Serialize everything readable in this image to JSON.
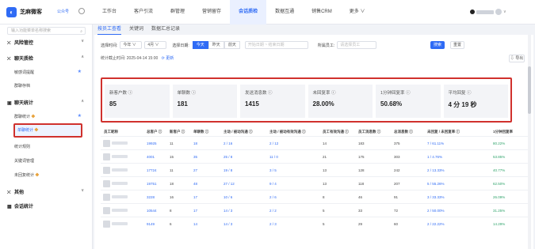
{
  "app": {
    "brand": "芝麻微客",
    "version": "公众号"
  },
  "nav": [
    "工作台",
    "客户引流",
    "群管理",
    "营销留存",
    "会话质检",
    "数据互通",
    "销售CRM",
    "更多"
  ],
  "nav_active_index": 4,
  "user": {
    "label": "..."
  },
  "sidebar": {
    "search_placeholder": "输入功能菜单名称搜索",
    "groups": [
      {
        "label": "风险管控",
        "chevron": "∨"
      },
      {
        "label": "聊天质检",
        "chevron": "∧",
        "items": [
          "敏感词提醒",
          "群聊存档"
        ]
      },
      {
        "label": "聊天统计",
        "chevron": "∧",
        "items": [
          "群聊统计",
          "单聊统计",
          "统计规则",
          "关键词管理",
          "未回复统计"
        ]
      },
      {
        "label": "其他",
        "chevron": "∨"
      },
      {
        "label": "会话统计",
        "chevron": ""
      }
    ]
  },
  "tabs": [
    "按员工查看",
    "关键词",
    "数据汇总记录"
  ],
  "filters": {
    "select_label": "选择时间:",
    "year": "今年",
    "month": "4月",
    "date_label": "选择日期:",
    "today": "今天",
    "yesterday": "昨天",
    "before_yesterday": "前天",
    "start_placeholder": "开始日期",
    "to": "~",
    "end_placeholder": "结束日期",
    "staff_label": "所属员工:",
    "staff_placeholder": "请选择员工",
    "search_btn": "搜索",
    "reset_btn": "重置"
  },
  "stat_time": {
    "label": "统计截止时间: 2025-04-14 15:00",
    "refresh": "更新"
  },
  "export_btn": "导出",
  "cards": [
    {
      "label": "新客户数 ⓘ",
      "value": "85"
    },
    {
      "label": "单聊数 ⓘ",
      "value": "181"
    },
    {
      "label": "发送消息数 ⓘ",
      "value": "1415"
    },
    {
      "label": "未回复率 ⓘ",
      "value": "28.00%"
    },
    {
      "label": "1分钟回复率 ⓘ",
      "value": "50.68%"
    },
    {
      "label": "平均回复 ⓘ",
      "value": "4 分 19 秒"
    }
  ],
  "table": {
    "headers": [
      "员工昵称",
      "总客户 ⓘ",
      "新客户 ⓘ",
      "单聊数 ⓘ",
      "主动 / 被动沟通 ⓘ",
      "主动 / 被动有效沟通 ⓘ",
      "员工有效沟通 ⓘ",
      "员工消息数 ⓘ",
      "总消息数 ⓘ",
      "未回复 / 未回复率 ⓘ",
      "1分钟回复率"
    ],
    "rows": [
      [
        "19925",
        "11",
        "18",
        "2 / 16",
        "2 / 12",
        "14",
        "183",
        "375",
        "7 / 61.11%",
        "80.22%"
      ],
      [
        "4001",
        "15",
        "35",
        "25 / 8",
        "11 / 0",
        "21",
        "175",
        "303",
        "1 / 4.76%",
        "53.85%"
      ],
      [
        "17724",
        "11",
        "27",
        "19 / 8",
        "3 / 5",
        "13",
        "128",
        "242",
        "2 / 13.33%",
        "40.77%"
      ],
      [
        "19751",
        "18",
        "48",
        "27 / 12",
        "9 / 4",
        "13",
        "118",
        "207",
        "5 / 55.26%",
        "62.50%"
      ],
      [
        "3228",
        "16",
        "17",
        "10 / 6",
        "2 / 6",
        "8",
        "46",
        "91",
        "3 / 33.33%",
        "26.09%"
      ],
      [
        "10544",
        "8",
        "17",
        "14 / 3",
        "2 / 2",
        "5",
        "33",
        "72",
        "2 / 50.00%",
        "31.25%"
      ],
      [
        "9149",
        "6",
        "14",
        "14 / 3",
        "2 / 3",
        "5",
        "29",
        "60",
        "2 / 22.22%",
        "14.29%"
      ]
    ]
  },
  "colors": {
    "accent": "#2f6bf5",
    "highlight": "#d0312d",
    "positive": "#2fa36b"
  }
}
